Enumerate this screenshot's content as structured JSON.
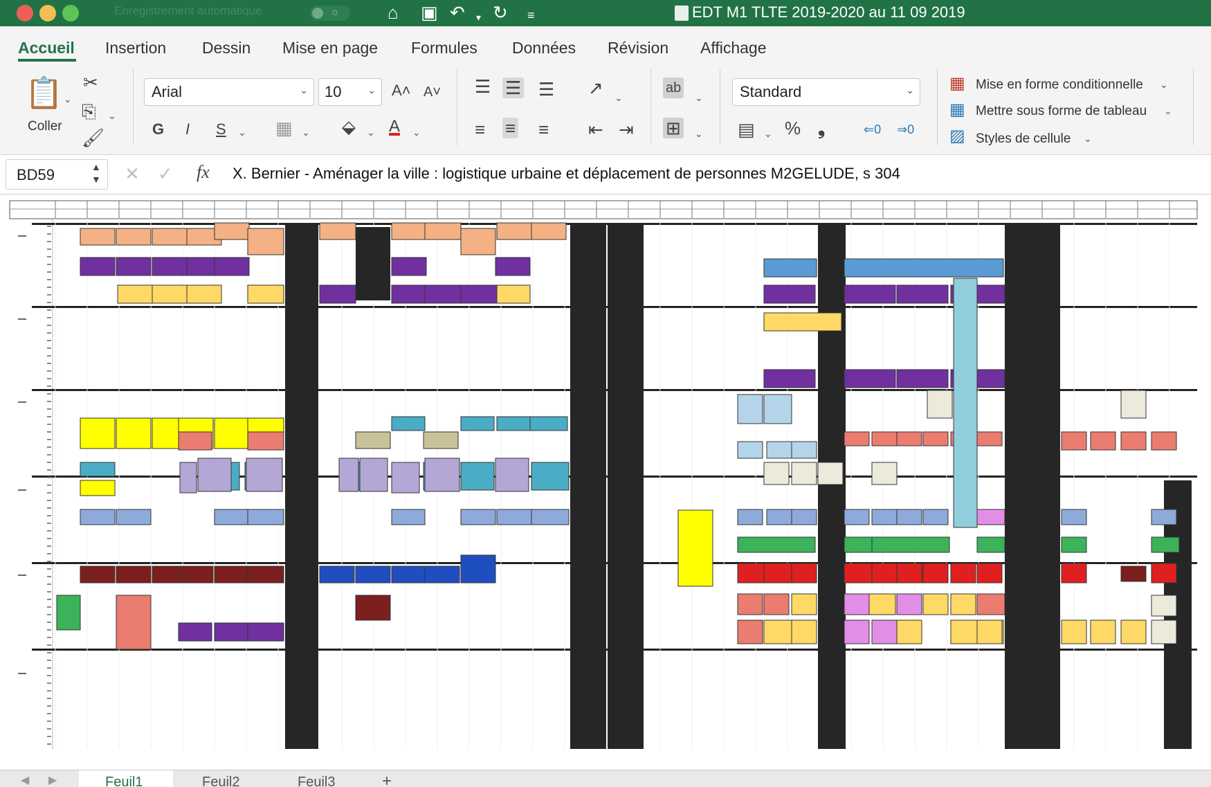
{
  "window": {
    "autosave_label": "Enregistrement automatique",
    "autosave_state": "o",
    "title": "EDT M1 TLTE 2019-2020 au 11 09 2019",
    "accent_color": "#217346"
  },
  "menu_tabs": [
    "Accueil",
    "Insertion",
    "Dessin",
    "Mise en page",
    "Formules",
    "Données",
    "Révision",
    "Affichage"
  ],
  "ribbon": {
    "paste_label": "Coller",
    "font_name": "Arial",
    "font_size": "10",
    "number_format": "Standard",
    "bold": "G",
    "italic": "I",
    "strike": "S",
    "percent": "%",
    "comma": "❟",
    "cond_format": "Mise en forme conditionnelle",
    "format_table": "Mettre sous forme de tableau",
    "cell_styles": "Styles de cellule"
  },
  "formula_bar": {
    "cell_ref": "BD59",
    "fx": "fx",
    "content": "X. Bernier - Aménager la ville : logistique urbaine et déplacement de personnes M2GELUDE,  s 304"
  },
  "sheet_tabs": [
    "Feuil1",
    "Feuil2",
    "Feuil3",
    "+"
  ],
  "schedule_colors": {
    "orange": "#f4b183",
    "purple": "#7030a0",
    "yellow": "#ffff00",
    "gold": "#ffd966",
    "dark": "#262626",
    "blue": "#5b9bd5",
    "steel": "#8eaadb",
    "teal": "#4bacc6",
    "salmon": "#ea7c70",
    "tan": "#c9c19a",
    "lavender": "#b4a7d6",
    "darkred": "#7b1f1f",
    "royal": "#1f4fbf",
    "green": "#3cb35a",
    "red": "#e02020",
    "pink": "#e28ee6",
    "lightblue": "#92cddc",
    "cream": "#eceadb",
    "paleblue": "#b4d4ea",
    "dkpurple": "#5b3b7a"
  }
}
